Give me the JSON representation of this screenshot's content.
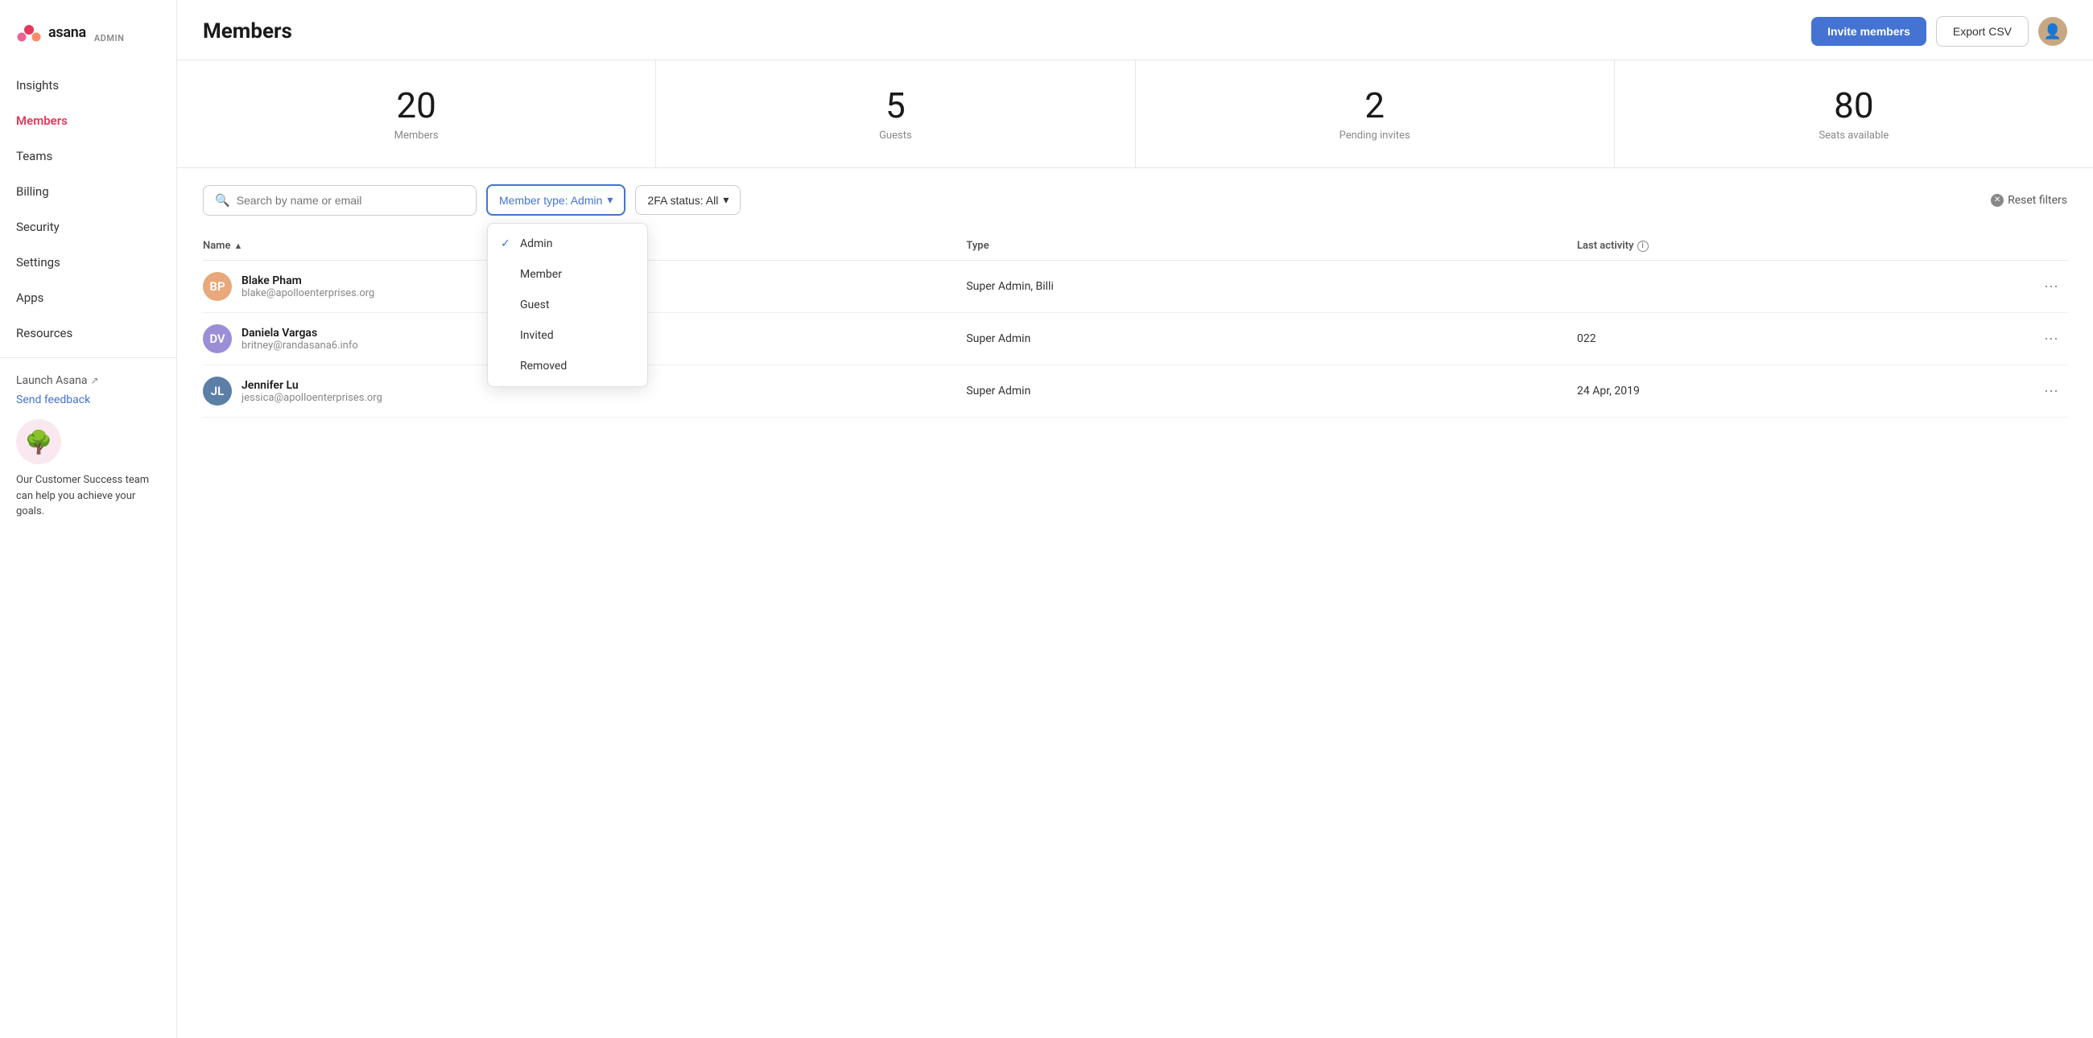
{
  "sidebar": {
    "logo": {
      "text": "asana",
      "admin_label": "ADMIN"
    },
    "nav_items": [
      {
        "id": "insights",
        "label": "Insights",
        "active": false
      },
      {
        "id": "members",
        "label": "Members",
        "active": true
      },
      {
        "id": "teams",
        "label": "Teams",
        "active": false
      },
      {
        "id": "billing",
        "label": "Billing",
        "active": false
      },
      {
        "id": "security",
        "label": "Security",
        "active": false
      },
      {
        "id": "settings",
        "label": "Settings",
        "active": false
      },
      {
        "id": "apps",
        "label": "Apps",
        "active": false
      },
      {
        "id": "resources",
        "label": "Resources",
        "active": false
      }
    ],
    "launch_asana": "Launch Asana",
    "send_feedback": "Send feedback",
    "success_text": "Our Customer Success team can help you achieve your goals."
  },
  "header": {
    "title": "Members",
    "invite_button": "Invite members",
    "export_button": "Export CSV"
  },
  "stats": [
    {
      "id": "members",
      "number": "20",
      "label": "Members"
    },
    {
      "id": "guests",
      "number": "5",
      "label": "Guests"
    },
    {
      "id": "pending",
      "number": "2",
      "label": "Pending invites"
    },
    {
      "id": "seats",
      "number": "80",
      "label": "Seats available"
    }
  ],
  "filters": {
    "search_placeholder": "Search by name or email",
    "member_type_label": "Member type: Admin",
    "twofa_label": "2FA status: All",
    "reset_label": "Reset filters"
  },
  "dropdown": {
    "options": [
      {
        "id": "admin",
        "label": "Admin",
        "selected": true
      },
      {
        "id": "member",
        "label": "Member",
        "selected": false
      },
      {
        "id": "guest",
        "label": "Guest",
        "selected": false
      },
      {
        "id": "invited",
        "label": "Invited",
        "selected": false
      },
      {
        "id": "removed",
        "label": "Removed",
        "selected": false
      }
    ]
  },
  "table": {
    "columns": [
      {
        "id": "name",
        "label": "Name",
        "sortable": true
      },
      {
        "id": "type",
        "label": "Type",
        "sortable": false
      },
      {
        "id": "activity",
        "label": "Last activity",
        "has_info": true
      }
    ],
    "rows": [
      {
        "id": "blake",
        "name": "Blake Pham",
        "email": "blake@apolloenterprises.org",
        "type": "Super Admin, Billi",
        "activity": "",
        "avatar_color": "#e8a87c",
        "initials": "BP"
      },
      {
        "id": "daniela",
        "name": "Daniela Vargas",
        "email": "britney@randasana6.info",
        "type": "Super Admin",
        "activity": "022",
        "avatar_color": "#9b8ed6",
        "initials": "DV"
      },
      {
        "id": "jennifer",
        "name": "Jennifer Lu",
        "email": "jessica@apolloenterprises.org",
        "type": "Super Admin",
        "activity": "24 Apr, 2019",
        "avatar_color": "#5b7fa6",
        "initials": "JL"
      }
    ]
  }
}
